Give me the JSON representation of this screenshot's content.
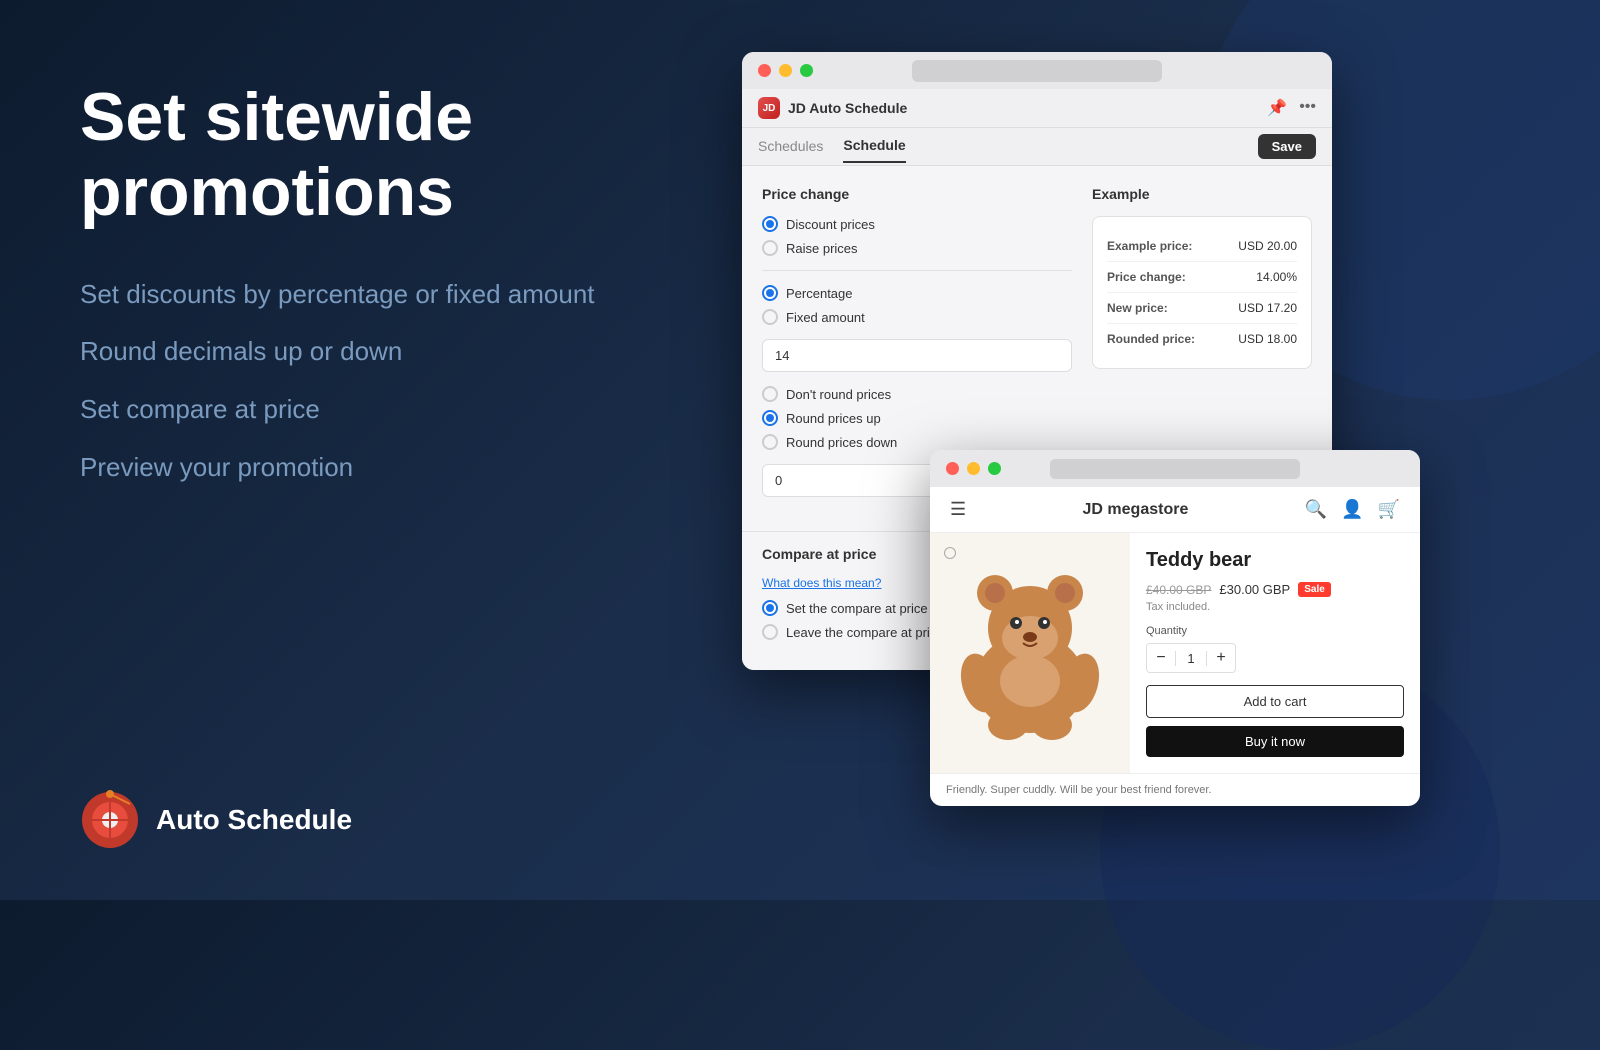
{
  "background": {
    "color_start": "#0d1b2e",
    "color_end": "#1e3560"
  },
  "left": {
    "main_title": "Set sitewide promotions",
    "features": [
      "Set discounts by percentage or fixed amount",
      "Round decimals up or down",
      "Set compare at price",
      "Preview your promotion"
    ]
  },
  "logo": {
    "text": "Auto Schedule"
  },
  "main_window": {
    "title": "JD Auto Schedule",
    "nav": {
      "schedules": "Schedules",
      "schedule": "Schedule",
      "save_btn": "Save"
    },
    "price_change": {
      "section_title": "Price change",
      "options_discount": [
        {
          "label": "Discount prices",
          "checked": true
        },
        {
          "label": "Raise prices",
          "checked": false
        }
      ],
      "options_type": [
        {
          "label": "Percentage",
          "checked": true
        },
        {
          "label": "Fixed amount",
          "checked": false
        }
      ],
      "amount_value": "14",
      "options_round": [
        {
          "label": "Don't round prices",
          "checked": false
        },
        {
          "label": "Round prices up",
          "checked": true
        },
        {
          "label": "Round prices down",
          "checked": false
        }
      ],
      "round_value": "0"
    },
    "example": {
      "section_title": "Example",
      "rows": [
        {
          "label": "Example price:",
          "value": "USD 20.00"
        },
        {
          "label": "Price change:",
          "value": "14.00%"
        },
        {
          "label": "New price:",
          "value": "USD 17.20"
        },
        {
          "label": "Rounded price:",
          "value": "USD 18.00"
        }
      ]
    },
    "compare_at_price": {
      "section_title": "Compare at price",
      "link_text": "What does this mean?",
      "options": [
        {
          "label": "Set the compare at price to",
          "checked": true
        },
        {
          "label": "Leave the compare at price",
          "checked": false
        }
      ]
    }
  },
  "product_window": {
    "store_name": "JD megastore",
    "product": {
      "name": "Teddy bear",
      "original_price": "£40.00 GBP",
      "new_price": "£30.00 GBP",
      "sale_badge": "Sale",
      "tax_note": "Tax included.",
      "quantity_label": "Quantity",
      "quantity": "1",
      "add_to_cart": "Add to cart",
      "buy_now": "Buy it now",
      "description": "Friendly. Super cuddly. Will be your best friend forever."
    }
  }
}
